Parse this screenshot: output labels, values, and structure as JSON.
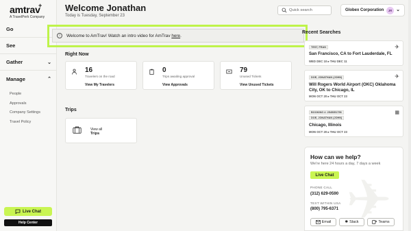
{
  "brand": {
    "logo": "amtrav",
    "logo_plus": "+",
    "tagline": "A TravelPerk Company"
  },
  "sidebar": {
    "go": "Go",
    "see": "See",
    "gather": "Gather",
    "manage": "Manage",
    "manage_items": [
      "People",
      "Approvals",
      "Company Settings",
      "Travel Policy"
    ],
    "live_chat": "Live Chat",
    "help_center": "Help Center"
  },
  "header": {
    "welcome": "Welcome Jonathan",
    "today": "Today is Tuesday, September 23",
    "search_placeholder": "Quick search",
    "company": "Globex Corporation",
    "avatar_initials": "JR"
  },
  "banner": {
    "text": "Welcome to AmTrav! Watch an intro video for AmTrav",
    "link": "here",
    "end": "."
  },
  "right_now": {
    "title": "Right Now",
    "cards": [
      {
        "value": "16",
        "desc": "Travelers on the road",
        "link": "View My Travelers"
      },
      {
        "value": "0",
        "desc": "Trips awaiting approval",
        "link": "View Approvals"
      },
      {
        "value": "79",
        "desc": "Unused Tickets",
        "link": "View Unused Tickets"
      }
    ]
  },
  "trips": {
    "title": "Trips",
    "view_all": "View all",
    "label": "Trips"
  },
  "recent": {
    "title": "Recent Searches",
    "items": [
      {
        "badge": "TEST, FRAN",
        "route": "San Francisco, CA to Fort Lauderdale, FL",
        "dates": "WED DEC 10  ▸  THU DEC 11"
      },
      {
        "badge": "DOE, JONATHAN (JOHN)",
        "route": "Will Rogers World Airport (OKC) Oklahoma City, OK to Chicago, IL",
        "dates": "MON OCT 20  ▸  THU OCT 23"
      },
      {
        "badge": "BOOKING #: 2545351756",
        "badge2": "DOE, JONATHAN (JOHN)",
        "route": "Chicago, Illinois",
        "dates": "MON OCT 20  ▸  THU OCT 23"
      }
    ]
  },
  "help": {
    "title": "How can we help?",
    "sub": "We're here 24 hours a day, 7 days a week",
    "chat": "Live Chat",
    "phone_label": "PHONE CALL",
    "phone": "(312) 629-0590",
    "text_label": "TEXT WITHIN USA",
    "text_number": "(800) 795-6371",
    "buttons": [
      "Email",
      "Slack",
      "Teams"
    ]
  },
  "colors": {
    "accent": "#c9f552",
    "highlight": "#bef34a"
  }
}
